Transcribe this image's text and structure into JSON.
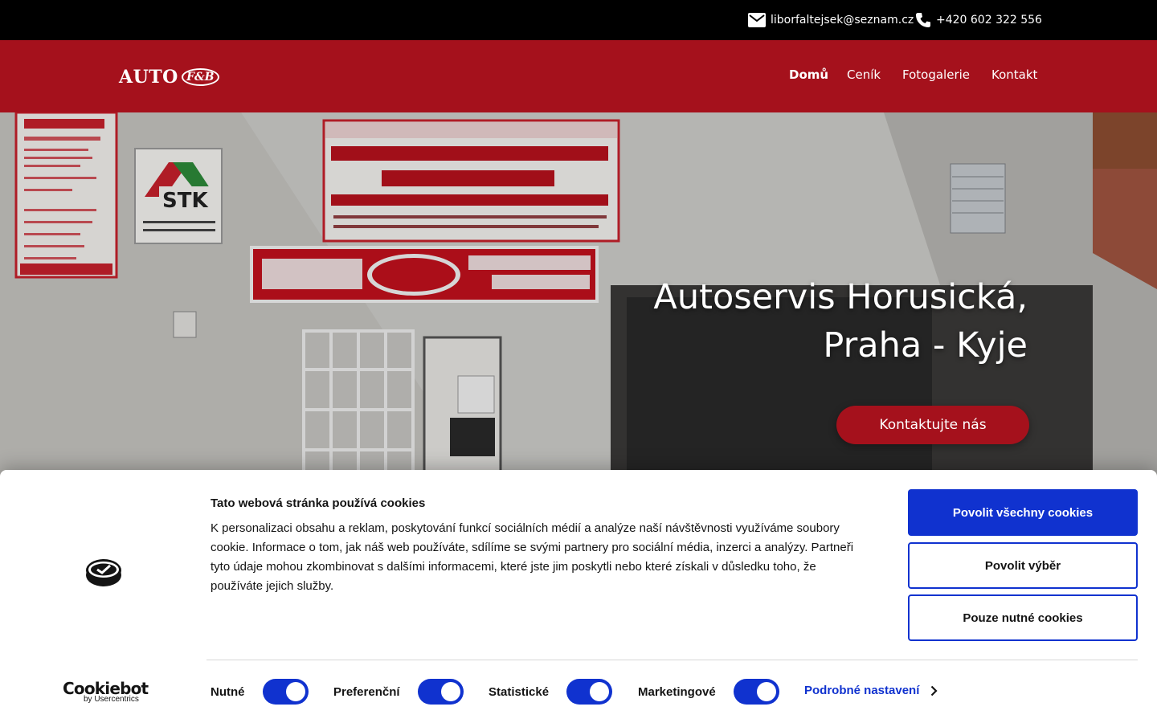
{
  "topbar": {
    "email": "liborfaltejsek@seznam.cz",
    "phone": "+420 602 322 556",
    "email_icon": "mail-icon",
    "phone_icon": "phone-icon"
  },
  "header": {
    "logo_text": "AUTO",
    "logo_badge": "F&B",
    "menu": {
      "home": "Domů",
      "pricing": "Ceník",
      "gallery": "Fotogalerie",
      "contact": "Kontakt"
    }
  },
  "hero": {
    "title_line1": "Autoservis Horusická,",
    "title_line2": "Praha - Kyje",
    "cta_label": "Kontaktujte nás"
  },
  "cookie_banner": {
    "heading": "Tato webová stránka používá cookies",
    "text": "K personalizaci obsahu a reklam, poskytování funkcí sociálních médií a analýze naší návštěvnosti využíváme soubory cookie. Informace o tom, jak náš web používáte, sdílíme se svými partnery pro sociální média, inzerci a analýzy. Partneři tyto údaje mohou zkombinovat s dalšími informacemi, které jste jim poskytli nebo které získali v důsledku toho, že používáte jejich služby.",
    "buttons": {
      "allow_all": "Povolit všechny cookies",
      "allow_selection": "Povolit výběr",
      "necessary_only": "Pouze nutné cookies"
    },
    "toggles": {
      "necessary": "Nutné",
      "preferences": "Preferenční",
      "statistics": "Statistické",
      "marketing": "Marketingové"
    },
    "details_link": "Podrobné nastavení",
    "brand": "Cookiebot",
    "brand_by": "by Usercentrics"
  },
  "colors": {
    "brand_red": "#a5111c",
    "cookie_blue": "#1032cf"
  }
}
